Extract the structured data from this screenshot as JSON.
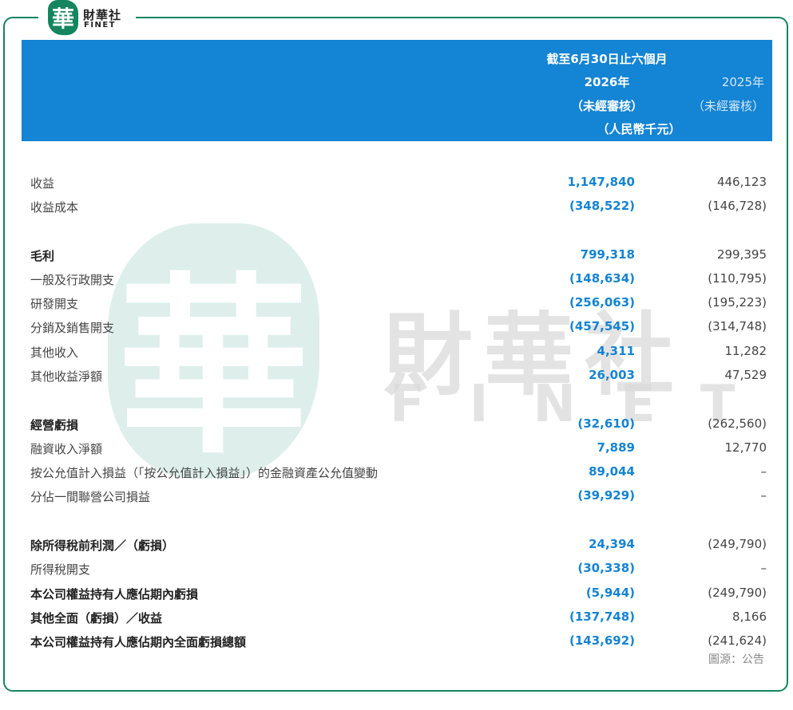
{
  "logo": {
    "mark": "華",
    "name_cn": "財華社",
    "name_en": "FINET"
  },
  "watermark": {
    "mark": "華",
    "name_cn": "財華社",
    "name_en": "FINET"
  },
  "header": {
    "period": "截至6月30日止六個月",
    "year_current": "2026年",
    "year_prior": "2025年",
    "audit_current": "（未經審核）",
    "audit_prior": "（未經審核）",
    "unit": "（人民幣千元）"
  },
  "rows": [
    {
      "label": "收益",
      "current": "1,147,840",
      "prior": "446,123",
      "bold": false
    },
    {
      "label": "收益成本",
      "current": "(348,522)",
      "prior": "(146,728)",
      "bold": false
    },
    {
      "label": "毛利",
      "current": "799,318",
      "prior": "299,395",
      "bold": true
    },
    {
      "label": "一般及行政開支",
      "current": "(148,634)",
      "prior": "(110,795)",
      "bold": false
    },
    {
      "label": "研發開支",
      "current": "(256,063)",
      "prior": "(195,223)",
      "bold": false
    },
    {
      "label": "分銷及銷售開支",
      "current": "(457,545)",
      "prior": "(314,748)",
      "bold": false
    },
    {
      "label": "其他收入",
      "current": "4,311",
      "prior": "11,282",
      "bold": false
    },
    {
      "label": "其他收益淨額",
      "current": "26,003",
      "prior": "47,529",
      "bold": false
    },
    {
      "label": "經營虧損",
      "current": "(32,610)",
      "prior": "(262,560)",
      "bold": true
    },
    {
      "label": "融資收入淨額",
      "current": "7,889",
      "prior": "12,770",
      "bold": false
    },
    {
      "label": "按公允值計入損益（「按公允值計入損益」）的金融資產公允值變動",
      "current": "89,044",
      "prior": "–",
      "bold": false
    },
    {
      "label": "分佔一間聯營公司損益",
      "current": "(39,929)",
      "prior": "–",
      "bold": false
    },
    {
      "label": "除所得稅前利潤／（虧損）",
      "current": "24,394",
      "prior": "(249,790)",
      "bold": true
    },
    {
      "label": "所得稅開支",
      "current": "(30,338)",
      "prior": "–",
      "bold": false
    },
    {
      "label": "本公司權益持有人應佔期內虧損",
      "current": "(5,944)",
      "prior": "(249,790)",
      "bold": true
    },
    {
      "label": "其他全面（虧損）／收益",
      "current": "(137,748)",
      "prior": "8,166",
      "bold": true
    },
    {
      "label": "本公司權益持有人應佔期內全面虧損總額",
      "current": "(143,692)",
      "prior": "(241,624)",
      "bold": true
    }
  ],
  "source": "圖源：公告",
  "colors": {
    "frame": "#14855f",
    "header_bg": "#1484d4",
    "value_current": "#1484d4"
  }
}
